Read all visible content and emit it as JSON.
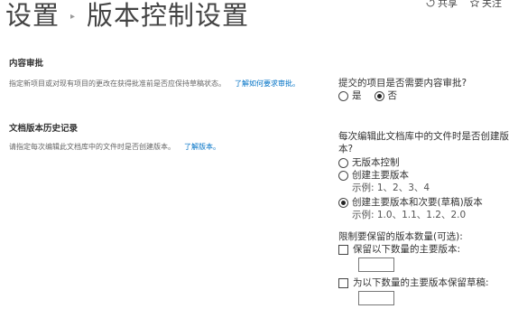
{
  "top_actions": {
    "share": "共享",
    "follow": "关注"
  },
  "breadcrumb": {
    "parent": "设置",
    "separator": "▸",
    "current": "版本控制设置"
  },
  "content_approval": {
    "heading": "内容审批",
    "description": "指定新项目或对现有项目的更改在获得批准前是否应保持草稿状态。",
    "link": "了解如何要求审批。",
    "question": "提交的项目是否需要内容审批?",
    "options": [
      {
        "label": "是",
        "checked": false
      },
      {
        "label": "否",
        "checked": true
      }
    ]
  },
  "version_history": {
    "heading": "文档版本历史记录",
    "description": "请指定每次编辑此文档库中的文件时是否创建版本。",
    "link": "了解版本。",
    "question": "每次编辑此文档库中的文件时是否创建版本?",
    "options": [
      {
        "label": "无版本控制",
        "checked": false,
        "example": ""
      },
      {
        "label": "创建主要版本",
        "checked": false,
        "example": "示例: 1、2、3、4"
      },
      {
        "label": "创建主要版本和次要(草稿)版本",
        "checked": true,
        "example": "示例: 1.0、1.1、1.2、2.0"
      }
    ],
    "limit_label": "限制要保留的版本数量(可选):",
    "keep_major_label": "保留以下数量的主要版本:",
    "keep_drafts_label": "为以下数量的主要版本保留草稿:",
    "keep_major_value": "",
    "keep_drafts_value": ""
  }
}
